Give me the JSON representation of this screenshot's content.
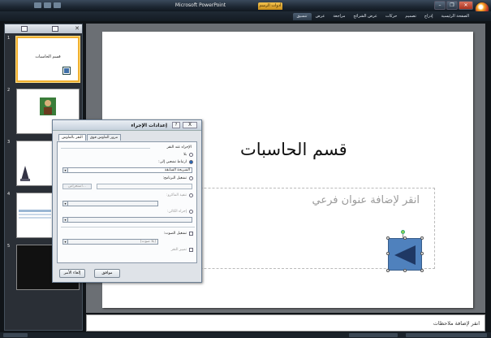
{
  "window": {
    "app_title": "Microsoft PowerPoint",
    "tools_tab": "أدوات الرسم"
  },
  "ribbon": {
    "tabs": [
      "الصفحة الرئيسية",
      "إدراج",
      "تصميم",
      "حركات",
      "عرض الشرائح",
      "مراجعة",
      "عرض",
      "تنسيق"
    ],
    "active_tab": "تنسيق"
  },
  "slides_panel": {
    "thumbnails": [
      {
        "number": "1",
        "title": "قسم الحاسبات"
      },
      {
        "number": "2"
      },
      {
        "number": "3"
      },
      {
        "number": "4"
      },
      {
        "number": "5"
      }
    ]
  },
  "slide": {
    "title": "قسم الحاسبات",
    "subtitle_placeholder": "انقر لإضافة عنوان فرعي"
  },
  "notes": {
    "placeholder": "انقر لإضافة ملاحظات"
  },
  "dialog": {
    "title": "إعدادات الإجراء",
    "help": "?",
    "close": "X",
    "tabs": [
      "النقر بالماوس",
      "مرور الماوس فوق"
    ],
    "section_title": "الإجراء عند النقر",
    "options": {
      "none": "بلا",
      "hyperlink": "ارتباط تشعبي إلى:",
      "hyperlink_value": "الشريحة السابقة",
      "run_program": "تشغيل البرنامج:",
      "browse": "استعراض...",
      "run_macro": "تنفيذ الماكرو:",
      "object_action": "إجراء الكائن:",
      "play_sound": "تشغيل الصوت:",
      "sound_value": "[بلا صوت]",
      "highlight": "تمييز النقر"
    },
    "buttons": {
      "ok": "موافق",
      "cancel": "إلغاء الأمر"
    }
  },
  "colors": {
    "accent_shape": "#4f81bd",
    "selected_thumb": "#f0b030"
  }
}
